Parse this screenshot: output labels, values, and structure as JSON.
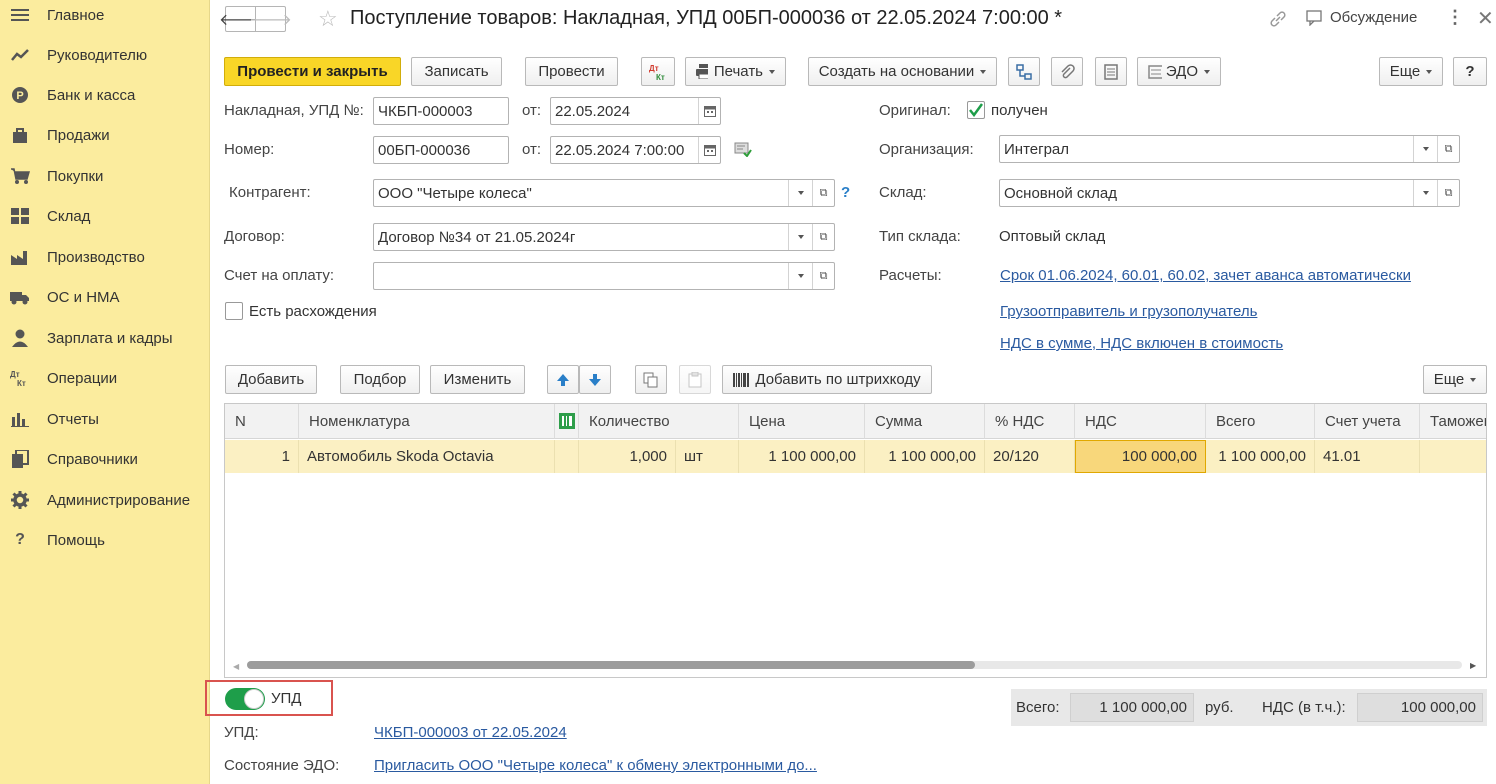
{
  "sidebar": {
    "items": [
      {
        "label": "Главное",
        "icon": "menu-icon"
      },
      {
        "label": "Руководителю",
        "icon": "trend-icon"
      },
      {
        "label": "Банк и касса",
        "icon": "coin-icon"
      },
      {
        "label": "Продажи",
        "icon": "bag-icon"
      },
      {
        "label": "Покупки",
        "icon": "cart-icon"
      },
      {
        "label": "Склад",
        "icon": "warehouse-icon"
      },
      {
        "label": "Производство",
        "icon": "factory-icon"
      },
      {
        "label": "ОС и НМА",
        "icon": "truck-icon"
      },
      {
        "label": "Зарплата и кадры",
        "icon": "person-icon"
      },
      {
        "label": "Операции",
        "icon": "dt-kt-icon"
      },
      {
        "label": "Отчеты",
        "icon": "bar-chart-icon"
      },
      {
        "label": "Справочники",
        "icon": "books-icon"
      },
      {
        "label": "Администрирование",
        "icon": "gear-icon"
      },
      {
        "label": "Помощь",
        "icon": "question-icon"
      }
    ]
  },
  "header": {
    "title": "Поступление товаров: Накладная, УПД 00БП-000036 от 22.05.2024 7:00:00 *",
    "discussion": "Обсуждение"
  },
  "toolbar": {
    "post_close": "Провести и закрыть",
    "save": "Записать",
    "post": "Провести",
    "dtkt": "Дт Кт",
    "print": "Печать",
    "create_based": "Создать на основании",
    "edo": "ЭДО",
    "more": "Еще",
    "help": "?"
  },
  "form": {
    "invoice_label": "Накладная, УПД №:",
    "invoice_no": "ЧКБП-000003",
    "from_label": "от:",
    "invoice_date": "22.05.2024",
    "number_label": "Номер:",
    "number": "00БП-000036",
    "number_date": "22.05.2024  7:00:00",
    "contractor_label": "Контрагент:",
    "contractor": "ООО \"Четыре колеса\"",
    "contract_label": "Договор:",
    "contract": "Договор №34 от 21.05.2024г",
    "invoice_pay_label": "Счет на оплату:",
    "invoice_pay": "",
    "discrepancy_label": "Есть расхождения",
    "original_label": "Оригинал:",
    "original_value": "получен",
    "org_label": "Организация:",
    "org": "Интеграл",
    "warehouse_label": "Склад:",
    "warehouse": "Основной склад",
    "wh_type_label": "Тип склада:",
    "wh_type": "Оптовый склад",
    "settlements_label": "Расчеты:",
    "settlements_link": "Срок 01.06.2024, 60.01, 60.02, зачет аванса автоматически",
    "shipper_link": "Грузоотправитель и грузополучатель",
    "vat_link": "НДС в сумме, НДС включен в стоимость"
  },
  "table_toolbar": {
    "add": "Добавить",
    "pick": "Подбор",
    "change": "Изменить",
    "barcode": "Добавить по штрихкоду",
    "more": "Еще"
  },
  "table": {
    "headers": [
      "N",
      "Номенклатура",
      "Количество",
      "Цена",
      "Сумма",
      "% НДС",
      "НДС",
      "Всего",
      "Счет учета",
      "Таможен"
    ],
    "rows": [
      {
        "n": "1",
        "item": "Автомобиль Skoda Octavia",
        "qty": "1,000",
        "unit": "шт",
        "price": "1 100 000,00",
        "sum": "1 100 000,00",
        "vat_rate": "20/120",
        "vat": "100 000,00",
        "total": "1 100 000,00",
        "account": "41.01"
      }
    ]
  },
  "footer": {
    "upd_toggle": "УПД",
    "upd_label": "УПД:",
    "upd_link": "ЧКБП-000003 от 22.05.2024",
    "edo_state_label": "Состояние ЭДО:",
    "edo_state_link": "Пригласить ООО \"Четыре колеса\" к обмену электронными до...",
    "total_label": "Всего:",
    "total_value": "1 100 000,00",
    "currency": "руб.",
    "vat_label": "НДС (в т.ч.):",
    "vat_value": "100 000,00"
  },
  "colors": {
    "accent": "#f9d627",
    "sidebar": "#fbec9e",
    "link": "#2a5aa0",
    "toggle": "#1e9e4a",
    "highlight": "#d9534f"
  }
}
